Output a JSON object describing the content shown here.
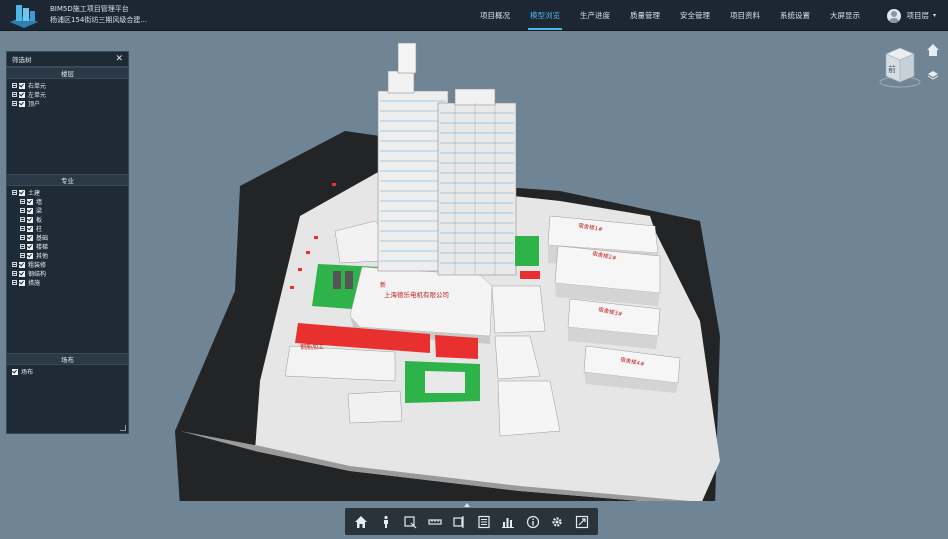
{
  "app": {
    "title": "BIM5D施工项目管理平台",
    "project": "杨浦区154街坊三期风级合建..."
  },
  "nav": {
    "items": [
      {
        "label": "项目概况",
        "active": false
      },
      {
        "label": "模型浏览",
        "active": true
      },
      {
        "label": "生产进度",
        "active": false
      },
      {
        "label": "质量管理",
        "active": false
      },
      {
        "label": "安全管理",
        "active": false
      },
      {
        "label": "项目资料",
        "active": false
      },
      {
        "label": "系统设置",
        "active": false
      },
      {
        "label": "大屏显示",
        "active": false
      }
    ]
  },
  "user": {
    "label": "项目层"
  },
  "filter": {
    "title": "筛选树",
    "sections": {
      "floors": {
        "title": "楼层",
        "items": [
          {
            "label": "右单元",
            "checked": true
          },
          {
            "label": "左单元",
            "checked": true
          },
          {
            "label": "顶户",
            "checked": true
          }
        ]
      },
      "discipline": {
        "title": "专业",
        "items": [
          {
            "label": "土建",
            "level": 0,
            "checked": true
          },
          {
            "label": "墙",
            "level": 1,
            "checked": true
          },
          {
            "label": "梁",
            "level": 1,
            "checked": true
          },
          {
            "label": "板",
            "level": 1,
            "checked": true
          },
          {
            "label": "柱",
            "level": 1,
            "checked": true
          },
          {
            "label": "基础",
            "level": 1,
            "checked": true
          },
          {
            "label": "楼梯",
            "level": 1,
            "checked": true
          },
          {
            "label": "其他",
            "level": 1,
            "checked": true
          },
          {
            "label": "粗装修",
            "level": 0,
            "checked": true
          },
          {
            "label": "钢结构",
            "level": 0,
            "checked": true
          },
          {
            "label": "措施",
            "level": 0,
            "checked": true
          }
        ]
      },
      "site": {
        "title": "场布",
        "items": [
          {
            "label": "场布",
            "checked": true
          }
        ]
      }
    }
  },
  "viewcube": {
    "face": "前"
  },
  "scene": {
    "labels": {
      "factory_sign": "上海德乐电机有限公司",
      "dorm1": "宿舍楼1#",
      "dorm2": "宿舍楼2#",
      "dorm3": "宿舍楼3#",
      "dorm4": "宿舍楼4#",
      "red_zone": "钢筋加工",
      "new_mark": "新"
    }
  },
  "toolbar": {
    "tools": [
      "home-icon",
      "walk-person-icon",
      "measure-area-icon",
      "ruler-icon",
      "section-box-icon",
      "properties-icon",
      "chart-icon",
      "info-icon",
      "settings-gear-icon",
      "fullscreen-icon"
    ]
  },
  "colors": {
    "topbar": "#1c2733",
    "accent": "#4fb7e8",
    "background": "#6f8494",
    "panel": "#1e2a36",
    "site_green": "#2eb34a",
    "site_red": "#e8312f"
  }
}
